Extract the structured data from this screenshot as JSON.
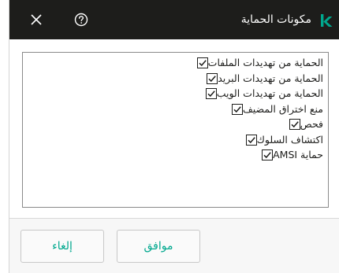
{
  "header": {
    "title": "مكونات الحماية",
    "brand_color": "#00a88e",
    "bar_color": "#1d1d1b",
    "close_icon": "close-icon",
    "help_icon": "help-icon"
  },
  "components": [
    {
      "label": "الحماية من تهديدات الملفات",
      "checked": true
    },
    {
      "label": "الحماية من تهديدات البريد",
      "checked": true
    },
    {
      "label": "الحماية من تهديدات الويب",
      "checked": true
    },
    {
      "label": "منع اختراق المضيف",
      "checked": true
    },
    {
      "label": "فحص",
      "checked": true
    },
    {
      "label": "اكتشاف السلوك",
      "checked": true
    },
    {
      "label": "حماية AMSI",
      "checked": true
    }
  ],
  "footer": {
    "ok_label": "موافق",
    "cancel_label": "إلغاء"
  }
}
